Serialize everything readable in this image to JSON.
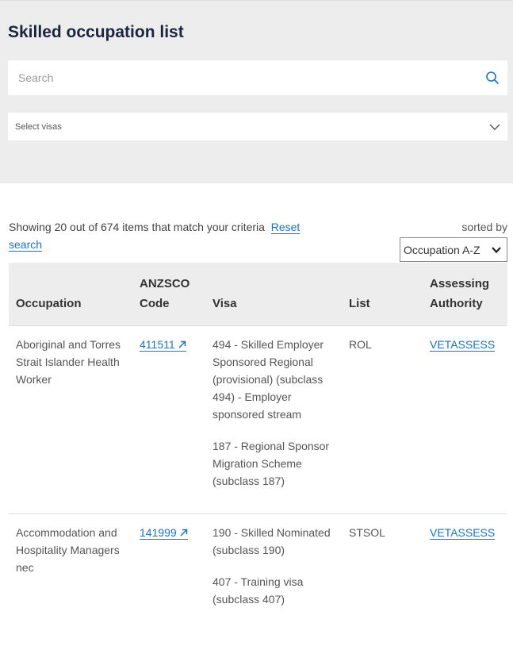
{
  "page": {
    "title": "Skilled occupation list"
  },
  "search": {
    "placeholder": "Search"
  },
  "visa_filter": {
    "label": "Select visas"
  },
  "results": {
    "summary": "Showing 20 out of 674 items that match your criteria",
    "reset_label": "Reset",
    "reset_label_2": "search",
    "sorted_by_label": "sorted by",
    "sort_value": "Occupation A-Z"
  },
  "table": {
    "headers": {
      "occupation": "Occupation",
      "anzsco_1": "ANZSCO",
      "anzsco_2": "Code",
      "visa": "Visa",
      "list": "List",
      "authority_1": "Assessing",
      "authority_2": "Authority"
    },
    "rows": [
      {
        "occupation": "Aboriginal and Torres Strait Islander Health Worker",
        "code": "411511",
        "visas": [
          "494 - Skilled Employer Sponsored Regional (provisional) (subclass 494) - Employer sponsored stream",
          "187 - Regional Sponsor Migration Scheme (subclass 187)"
        ],
        "list": "ROL",
        "authority": "VETASSESS"
      },
      {
        "occupation": "Accommodation and Hospitality Managers nec",
        "code": "141999",
        "visas": [
          "190 - Skilled Nominated (subclass 190)",
          "407 - Training visa (subclass 407)"
        ],
        "list": "STSOL",
        "authority": "VETASSESS"
      }
    ]
  },
  "colors": {
    "link": "#1a73c4",
    "panel": "#ededed",
    "title": "#1c2540"
  }
}
